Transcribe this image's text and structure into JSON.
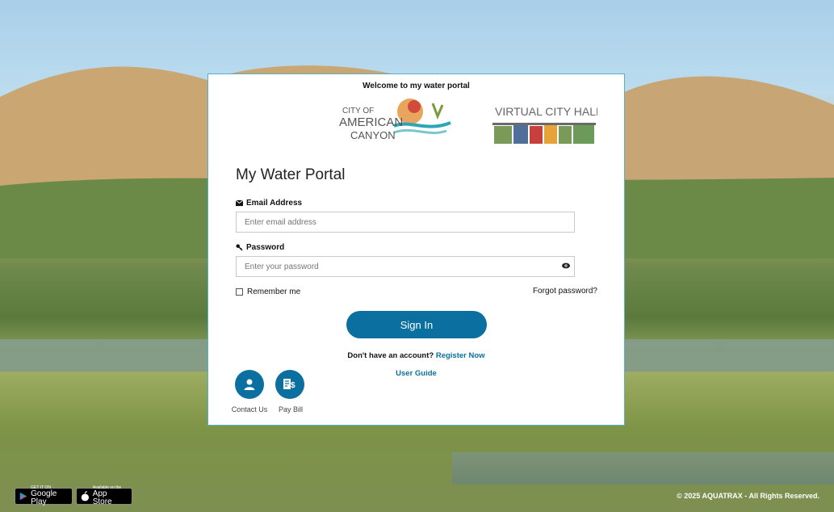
{
  "welcome": "Welcome to my water portal",
  "logos": {
    "city": {
      "line1": "CITY OF",
      "line2": "AMERICAN",
      "line3": "CANYON"
    },
    "vch": "VIRTUAL CITY HALL"
  },
  "form": {
    "title": "My Water Portal",
    "email_label": "Email Address",
    "email_placeholder": "Enter email address",
    "password_label": "Password",
    "password_placeholder": "Enter your password",
    "remember": "Remember me",
    "forgot": "Forgot password?",
    "signin": "Sign In",
    "no_account": "Don't have an account?",
    "register": "Register Now",
    "user_guide": "User Guide"
  },
  "quick": [
    {
      "label": "Contact Us",
      "icon": "user-icon"
    },
    {
      "label": "Pay Bill",
      "icon": "bill-icon"
    }
  ],
  "stores": {
    "google": {
      "small": "GET IT ON",
      "large": "Google Play"
    },
    "apple": {
      "small": "Available on the",
      "large": "App Store"
    }
  },
  "footer": "© 2025 AQUATRAX - All Rights Reserved.",
  "colors": {
    "accent": "#0b6fa0",
    "border": "#4fb3c9"
  }
}
